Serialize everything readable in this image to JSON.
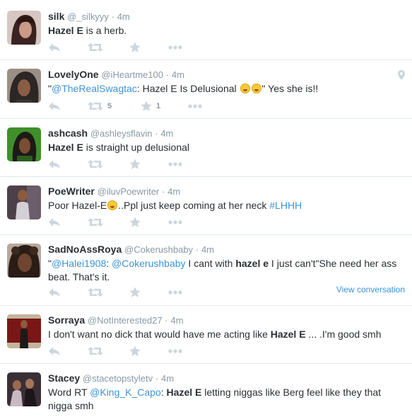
{
  "tweets": [
    {
      "fullname": "silk",
      "handle": "@_silkyyy",
      "dot": "·",
      "time": "4m",
      "parts": [
        {
          "t": "Hazel E",
          "s": "b"
        },
        {
          "t": " is a herb."
        }
      ],
      "retweet_count": "",
      "favorite_count": ""
    },
    {
      "fullname": "LovelyOne",
      "handle": "@iHeartme100",
      "dot": "·",
      "time": "4m",
      "parts": [
        {
          "t": "\""
        },
        {
          "t": "@TheRealSwagtac",
          "s": "link"
        },
        {
          "t": ": Hazel E Is Delusional "
        },
        {
          "t": "",
          "s": "emoji"
        },
        {
          "t": "",
          "s": "emoji"
        },
        {
          "t": "\" Yes she is!!"
        }
      ],
      "retweet_count": "5",
      "favorite_count": "1",
      "has_geo": true
    },
    {
      "fullname": "ashcash",
      "handle": "@ashleysflavin",
      "dot": "·",
      "time": "4m",
      "parts": [
        {
          "t": "Hazel E",
          "s": "b"
        },
        {
          "t": " is straight up delusional"
        }
      ],
      "retweet_count": "",
      "favorite_count": ""
    },
    {
      "fullname": "PoeWriter",
      "handle": "@iluvPoewriter",
      "dot": "·",
      "time": "4m",
      "parts": [
        {
          "t": "Poor Hazel-E"
        },
        {
          "t": "",
          "s": "emoji"
        },
        {
          "t": "..Ppl just keep coming at her neck "
        },
        {
          "t": "#LHHH",
          "s": "link"
        }
      ],
      "retweet_count": "",
      "favorite_count": ""
    },
    {
      "fullname": "SadNoAssRoya",
      "handle": "@Cokerushbaby",
      "dot": "·",
      "time": "4m",
      "parts": [
        {
          "t": "\""
        },
        {
          "t": "@Halei1908",
          "s": "link"
        },
        {
          "t": ": "
        },
        {
          "t": "@Cokerushbaby",
          "s": "link"
        },
        {
          "t": " I cant with "
        },
        {
          "t": "hazel e",
          "s": "b"
        },
        {
          "t": " I just can't\"She need her ass beat. That's it."
        }
      ],
      "retweet_count": "",
      "favorite_count": "",
      "view_conversation": "View conversation"
    },
    {
      "fullname": "Sorraya",
      "handle": "@NotInterested27",
      "dot": "·",
      "time": "4m",
      "parts": [
        {
          "t": "I don't want no dick that would have me acting like "
        },
        {
          "t": "Hazel E",
          "s": "b"
        },
        {
          "t": " ... .I'm good smh"
        }
      ],
      "retweet_count": "",
      "favorite_count": ""
    },
    {
      "fullname": "Stacey",
      "handle": "@stacetopstyletv",
      "dot": "·",
      "time": "4m",
      "parts": [
        {
          "t": "Word RT "
        },
        {
          "t": "@King_K_Capo",
          "s": "link"
        },
        {
          "t": ": "
        },
        {
          "t": "Hazel E",
          "s": "b"
        },
        {
          "t": " letting niggas like Berg feel like they that nigga smh"
        }
      ],
      "retweet_count": "",
      "favorite_count": ""
    }
  ],
  "colors": {
    "action_icon": "#ccd6dd",
    "link": "#3b94d9",
    "divider": "#e1e8ed",
    "meta_text": "#8899a6"
  },
  "icons": [
    "reply-icon",
    "retweet-icon",
    "favorite-icon",
    "more-icon",
    "geo-pin-icon"
  ]
}
